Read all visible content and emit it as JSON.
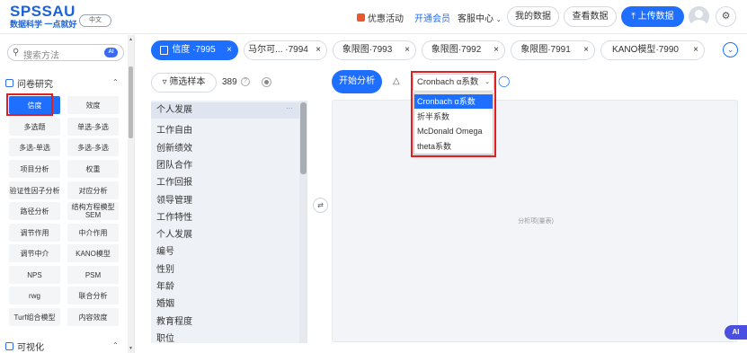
{
  "header": {
    "brand": "SPSSAU",
    "slogan": "数据科学 一点就好",
    "language": "中文",
    "promo": "优惠活动",
    "member": "开通会员",
    "service": "客服中心",
    "my_data": "我的数据",
    "view_data": "查看数据",
    "upload": "上传数据"
  },
  "sidebar": {
    "search_placeholder": "搜索方法",
    "ai_badge": "AI",
    "section1": "问卷研究",
    "section2": "可视化",
    "methods": [
      "信度",
      "效度",
      "多选题",
      "单选-多选",
      "多选-单选",
      "多选-多选",
      "项目分析",
      "权重",
      "验证性因子分析",
      "对应分析",
      "路径分析",
      "结构方程模型SEM",
      "调节作用",
      "中介作用",
      "调节中介",
      "KANO模型",
      "NPS",
      "PSM",
      "rwg",
      "联合分析",
      "Turf组合模型",
      "内容效度"
    ]
  },
  "tabs": [
    {
      "label": "信度 ·7995",
      "active": true
    },
    {
      "label": "马尔可... ·7994",
      "active": false
    },
    {
      "label": "象限图·7993",
      "active": false
    },
    {
      "label": "象限图·7992",
      "active": false
    },
    {
      "label": "象限图·7991",
      "active": false
    },
    {
      "label": "KANO模型·7990",
      "active": false
    }
  ],
  "filter": {
    "label": "筛选样本",
    "count": "389"
  },
  "variables": [
    "个人发展",
    "工作自由",
    "创新绩效",
    "团队合作",
    "工作回报",
    "领导管理",
    "工作特性",
    "个人发展",
    "编号",
    "性别",
    "年龄",
    "婚姻",
    "教育程度",
    "职位"
  ],
  "analysis": {
    "start": "开始分析",
    "selected": "Cronbach α系数",
    "options": [
      "Cronbach α系数",
      "折半系数",
      "McDonald Omega",
      "theta系数"
    ],
    "result_placeholder": "分析项(量表)",
    "ai_float": "AI"
  },
  "colors": {
    "accent": "#1e6fff",
    "highlight": "#e02020"
  }
}
